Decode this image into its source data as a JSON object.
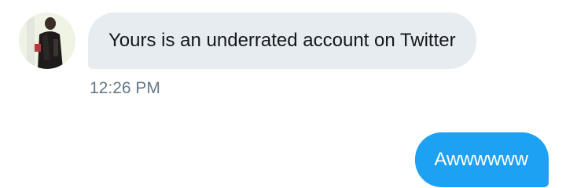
{
  "conversation": {
    "incoming": {
      "avatar_icon": "user-avatar-photo",
      "text": "Yours is an underrated account on Twitter",
      "timestamp": "12:26 PM"
    },
    "outgoing": {
      "text": "Awwwwww"
    }
  },
  "colors": {
    "incoming_bubble": "#e6ecf0",
    "outgoing_bubble": "#1da1f2",
    "timestamp": "#657786",
    "text_dark": "#14171a"
  }
}
